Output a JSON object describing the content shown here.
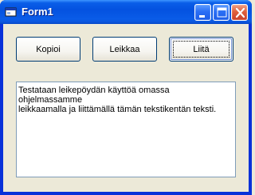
{
  "window": {
    "title": "Form1",
    "colors": {
      "titlebar": "#0a5ee8",
      "client": "#ece9d8",
      "close": "#e0613d"
    }
  },
  "titlebar_buttons": {
    "minimize": "minimize-icon",
    "maximize": "maximize-icon",
    "close": "close-icon"
  },
  "buttons": {
    "copy_label": "Kopioi",
    "cut_label": "Leikkaa",
    "paste_label": "Liitä"
  },
  "textbox": {
    "value": "Testataan leikepöydän käyttöä omassa ohjelmassamme\nleikkaamalla ja liittämällä tämän tekstikentän teksti."
  }
}
